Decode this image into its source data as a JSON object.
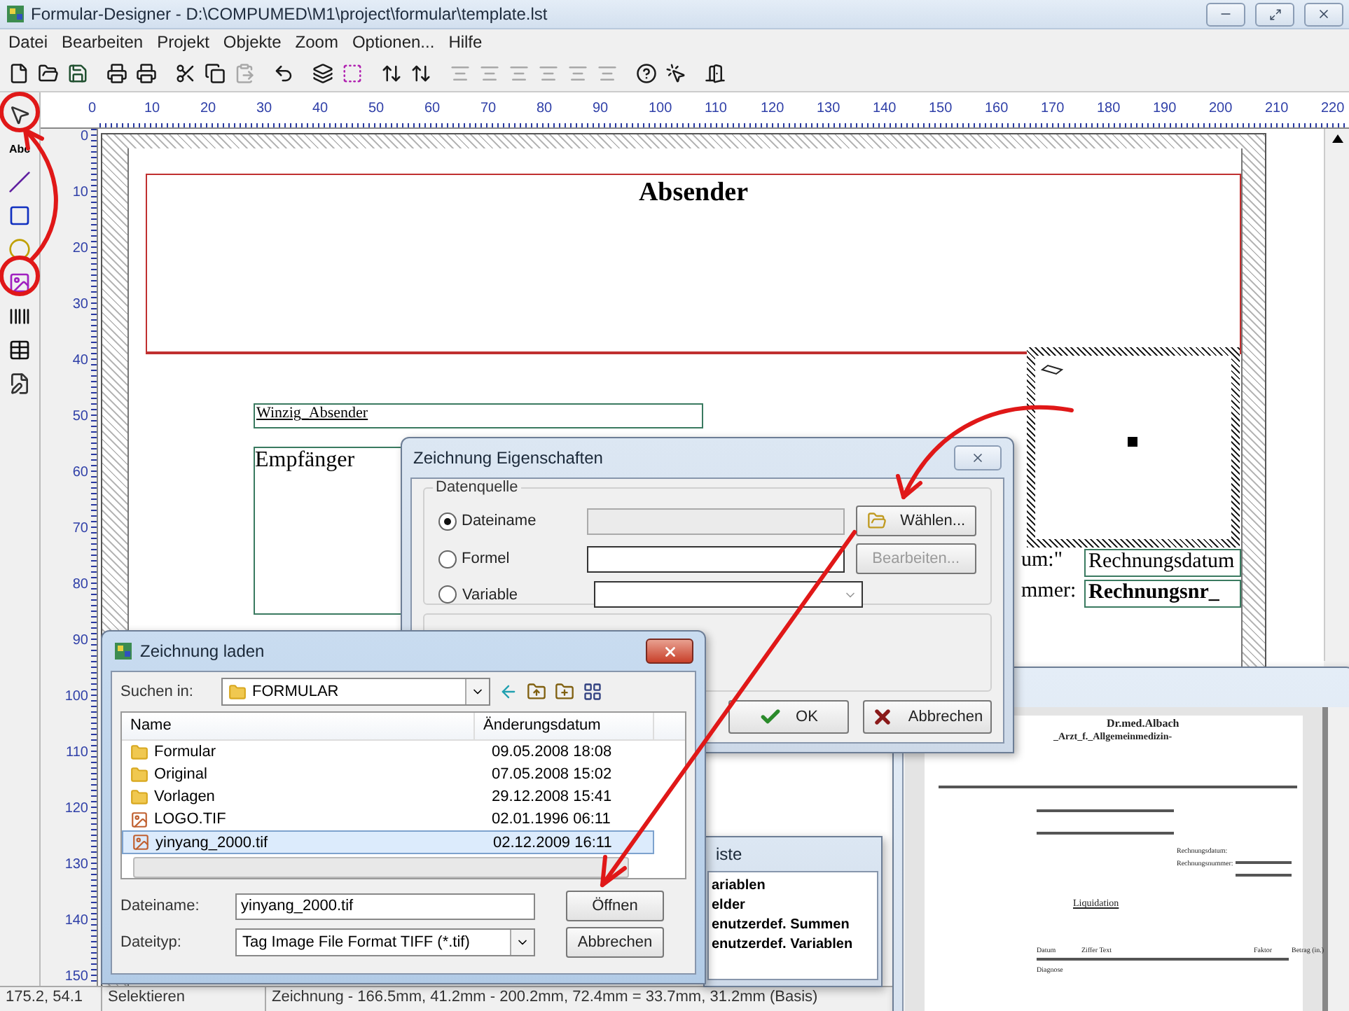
{
  "window": {
    "title": "Formular-Designer - D:\\COMPUMED\\M1\\project\\formular\\template.lst"
  },
  "menu": [
    "Datei",
    "Bearbeiten",
    "Projekt",
    "Objekte",
    "Zoom",
    "Optionen...",
    "Hilfe"
  ],
  "toolbar": [
    [
      {
        "kind": "new",
        "disabled": false
      },
      {
        "kind": "open",
        "disabled": false
      },
      {
        "kind": "save",
        "disabled": false
      }
    ],
    [
      {
        "kind": "print",
        "disabled": false
      },
      {
        "kind": "print",
        "disabled": false
      }
    ],
    [
      {
        "kind": "cut",
        "disabled": false
      },
      {
        "kind": "copy",
        "disabled": false
      },
      {
        "kind": "paste",
        "disabled": true
      }
    ],
    [
      {
        "kind": "undo",
        "disabled": false
      }
    ],
    [
      {
        "kind": "layers",
        "disabled": false
      },
      {
        "kind": "frame",
        "disabled": false
      }
    ],
    [
      {
        "kind": "arrange",
        "disabled": false
      },
      {
        "kind": "arrange",
        "disabled": false
      }
    ],
    [
      {
        "kind": "align",
        "disabled": true
      },
      {
        "kind": "align",
        "disabled": true
      },
      {
        "kind": "align",
        "disabled": true
      },
      {
        "kind": "align",
        "disabled": true
      },
      {
        "kind": "align",
        "disabled": true
      },
      {
        "kind": "align",
        "disabled": true
      }
    ],
    [
      {
        "kind": "help",
        "disabled": false
      },
      {
        "kind": "context-help",
        "disabled": false
      }
    ],
    [
      {
        "kind": "exit",
        "disabled": false
      }
    ]
  ],
  "tools": [
    {
      "kind": "select"
    },
    {
      "kind": "text",
      "label": "Abc"
    },
    {
      "kind": "line"
    },
    {
      "kind": "rectangle"
    },
    {
      "kind": "ellipse"
    },
    {
      "kind": "picture"
    },
    {
      "kind": "barcode"
    },
    {
      "kind": "table"
    },
    {
      "kind": "form"
    }
  ],
  "ruler": {
    "x_labels": [
      "0",
      "10",
      "20",
      "30",
      "40",
      "50",
      "60",
      "70",
      "80",
      "90",
      "100",
      "110",
      "120",
      "130",
      "140",
      "150",
      "160",
      "170",
      "180",
      "190",
      "200",
      "210",
      "220"
    ],
    "y_labels": [
      "0",
      "10",
      "20",
      "30",
      "40",
      "50",
      "60",
      "70",
      "80",
      "90",
      "100",
      "110",
      "120",
      "130",
      "140",
      "150"
    ]
  },
  "canvas": {
    "objects": [
      {
        "kind": "heading",
        "text": "Absender"
      },
      {
        "kind": "small",
        "text": "Winzig_Absender"
      },
      {
        "kind": "address",
        "text": "Empfänger"
      },
      {
        "kind": "picture-object"
      },
      {
        "kind": "label",
        "text": "um:\""
      },
      {
        "kind": "value",
        "text": "Rechnungsdatum"
      },
      {
        "kind": "label",
        "text": "mmer:"
      },
      {
        "kind": "value-bold",
        "text": "Rechnungsnr_"
      }
    ]
  },
  "properties_dialog": {
    "title": "Zeichnung Eigenschaften",
    "group": "Datenquelle",
    "sources": [
      {
        "kind": "file",
        "label": "Dateiname",
        "selected": true,
        "button": "Wählen...",
        "disabled": false
      },
      {
        "kind": "formula",
        "label": "Formel",
        "selected": false,
        "button": "Bearbeiten...",
        "disabled": true
      },
      {
        "kind": "variable",
        "label": "Variable",
        "selected": false
      }
    ],
    "ok": "OK",
    "cancel": "Abbrechen"
  },
  "open_dialog": {
    "title": "Zeichnung laden",
    "look_in_label": "Suchen in:",
    "look_in": "FORMULAR",
    "columns": [
      "Name",
      "Änderungsdatum"
    ],
    "files": [
      {
        "kind": "folder",
        "name": "Formular",
        "date": "09.05.2008 18:08",
        "selected": false
      },
      {
        "kind": "folder",
        "name": "Original",
        "date": "07.05.2008 15:02",
        "selected": false
      },
      {
        "kind": "folder",
        "name": "Vorlagen",
        "date": "29.12.2008 15:41",
        "selected": false
      },
      {
        "kind": "image",
        "name": "LOGO.TIF",
        "date": "02.01.1996 06:11",
        "selected": false
      },
      {
        "kind": "image",
        "name": "yinyang_2000.tif",
        "date": "02.12.2009 16:11",
        "selected": true
      }
    ],
    "filename_label": "Dateiname:",
    "filename": "yinyang_2000.tif",
    "type_label": "Dateityp:",
    "type": "Tag Image File Format TIFF (*.tif)",
    "open": "Öffnen",
    "cancel": "Abbrechen"
  },
  "list_window": {
    "title": "iste",
    "items": [
      "ariablen",
      "elder",
      "enutzerdef. Summen",
      "enutzerdef. Variablen"
    ]
  },
  "preview": {
    "texts": [
      {
        "kind": "title",
        "text": "Dr.med.Albach"
      },
      {
        "kind": "subtitle",
        "text": "_Arzt_f._Allgemeinmedizin-"
      },
      {
        "kind": "field",
        "text": "Rechnungsdatum:"
      },
      {
        "kind": "field",
        "text": "Rechnungsnummer:"
      },
      {
        "kind": "heading",
        "text": "Liquidation"
      },
      {
        "kind": "column",
        "text": "Datum"
      },
      {
        "kind": "column",
        "text": "Ziffer Text"
      },
      {
        "kind": "column",
        "text": "Faktor"
      },
      {
        "kind": "column",
        "text": "Betrag (in.)"
      },
      {
        "kind": "row",
        "text": "Diagnose"
      }
    ]
  },
  "status_bar": [
    "175.2, 54.1",
    "Selektieren",
    "Zeichnung - 166.5mm, 41.2mm - 200.2mm, 72.4mm = 33.7mm, 31.2mm (Basis)"
  ]
}
